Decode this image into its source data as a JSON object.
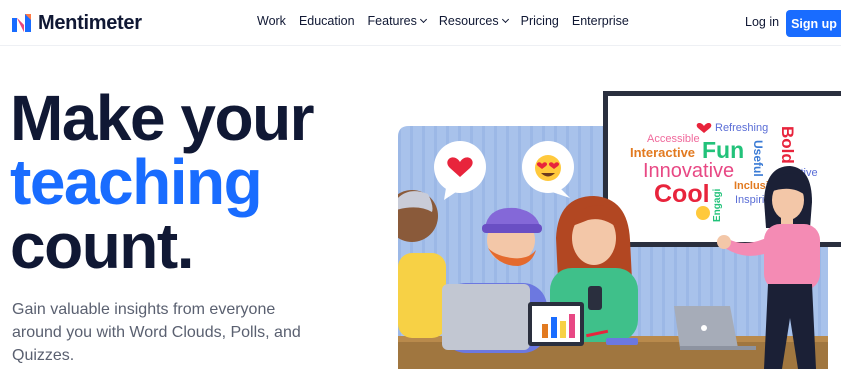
{
  "brand": {
    "name": "Mentimeter"
  },
  "nav": {
    "items": [
      {
        "label": "Work",
        "dropdown": false
      },
      {
        "label": "Education",
        "dropdown": false
      },
      {
        "label": "Features",
        "dropdown": true
      },
      {
        "label": "Resources",
        "dropdown": true
      },
      {
        "label": "Pricing",
        "dropdown": false
      },
      {
        "label": "Enterprise",
        "dropdown": false
      }
    ],
    "login": "Log in",
    "signup": "Sign up"
  },
  "hero": {
    "line1": "Make your",
    "line2": "teaching",
    "line3": "count.",
    "subtitle": "Gain valuable insights from everyone around you with Word Clouds, Polls, and Quizzes."
  },
  "wordcloud": {
    "words": [
      "Refreshing",
      "Bold",
      "Accessible",
      "Interactive",
      "Fun",
      "Useful",
      "Innovative",
      "ctive",
      "Cool",
      "Engagi",
      "Inclusive",
      "Inspirin"
    ]
  },
  "colors": {
    "accent": "#196cff",
    "text": "#101834",
    "subtext": "#5a6070",
    "signup_bg": "#196cff"
  },
  "icons": [
    "mentimeter-logo-icon",
    "chevron-down-icon",
    "heart-icon",
    "heart-eyes-emoji-icon",
    "laptop-icon"
  ]
}
